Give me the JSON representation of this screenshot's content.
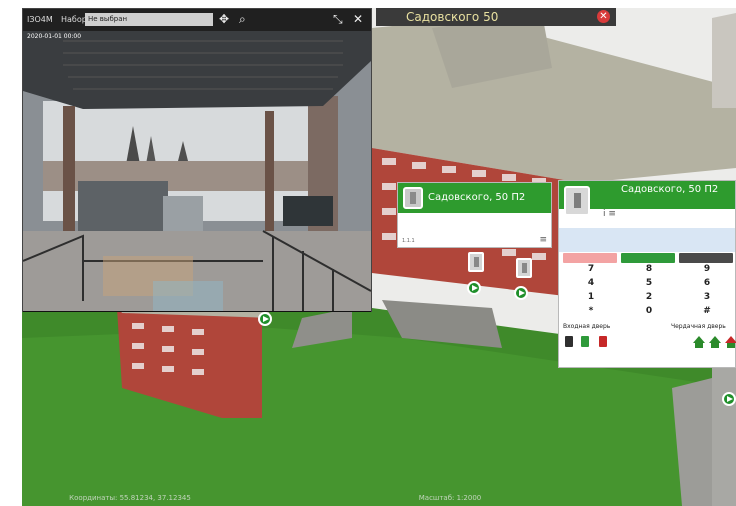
{
  "map": {
    "title": "Садовского 50",
    "close_icon": "close-icon",
    "colors": {
      "grass": "#3f8a2a",
      "brick": "#b0463a",
      "roof": "#b4b2a2",
      "header_green": "#2e9b2e"
    }
  },
  "camera": {
    "toolbar_label_1": "IЗО4М",
    "toolbar_label_2": "Набор:",
    "preset_select_value": "Не выбран",
    "timestamp": "2020-01-01 00:00",
    "icons": [
      "move-icon",
      "zoom-icon",
      "resize-icon",
      "close-icon"
    ]
  },
  "widget_small": {
    "title": "Садовского, 50 П2",
    "bottom_text": "1.1.1",
    "menu_icon": "≡"
  },
  "widget_large": {
    "title": "Садовского, 50 П2",
    "subrow_text": "i   ≡",
    "call_buttons": [
      {
        "icon": "delete-icon",
        "color": "#f3a3a3"
      },
      {
        "icon": "call-icon",
        "color": "#2f9a3a"
      },
      {
        "icon": "hangup-icon",
        "color": "#4a4a4a"
      }
    ],
    "keypad": [
      "7",
      "8",
      "9",
      "4",
      "5",
      "6",
      "1",
      "2",
      "3",
      "*",
      "0",
      "#"
    ],
    "left_label": "Входная дверь",
    "right_label": "Чердачная дверь"
  },
  "status": {
    "left": "Координаты: 55.81234, 37.12345",
    "center": "Масштаб: 1:2000"
  }
}
